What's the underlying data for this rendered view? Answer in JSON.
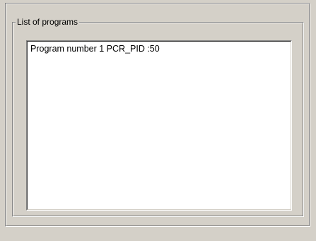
{
  "group": {
    "legend": "List of programs"
  },
  "programs": {
    "items": [
      {
        "label": "Program number 1 PCR_PID :50"
      }
    ]
  }
}
